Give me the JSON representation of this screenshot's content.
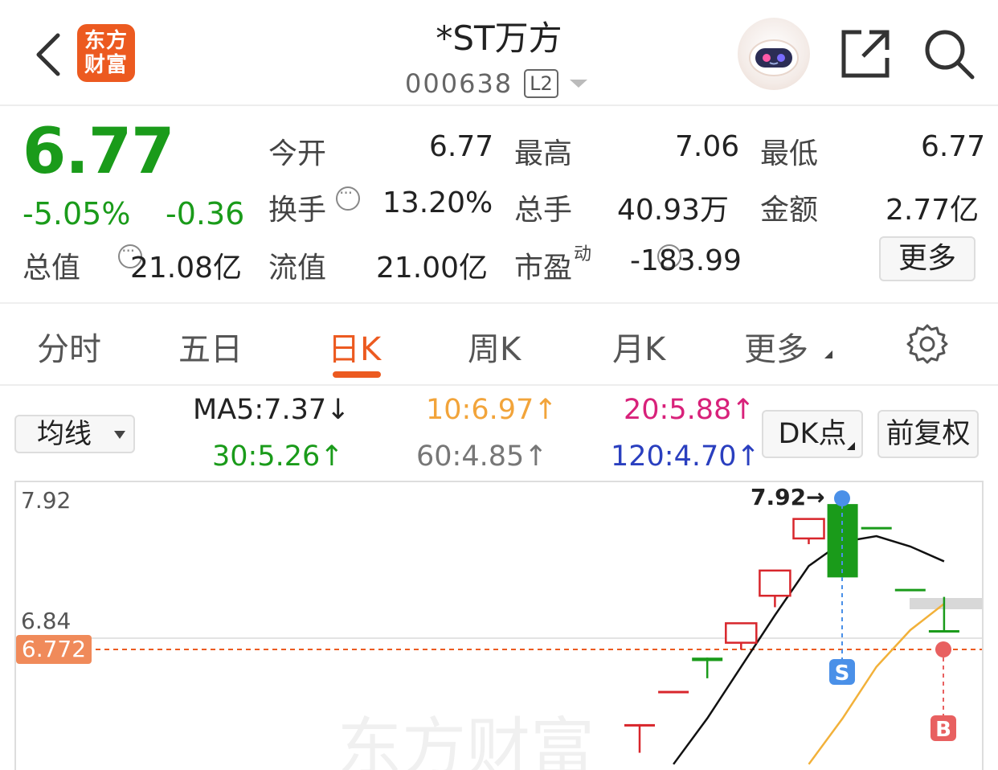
{
  "header": {
    "logo_line1": "东方",
    "logo_line2": "财富",
    "title": "*ST万方",
    "code": "000638",
    "level_badge": "L2",
    "icons": [
      "back-chevron-icon",
      "robot-avatar-icon",
      "share-icon",
      "search-icon"
    ]
  },
  "quote": {
    "price": "6.77",
    "change_pct": "-5.05%",
    "change": "-0.36",
    "cells": [
      {
        "label": "今开",
        "value": "6.77",
        "color": "#1a9b1a"
      },
      {
        "label": "最高",
        "value": "7.06",
        "color": "#1a9b1a"
      },
      {
        "label": "最低",
        "value": "6.77",
        "color": "#1a9b1a"
      },
      {
        "label": "换手",
        "value": "13.20%",
        "color": "#222"
      },
      {
        "label": "总手",
        "value": "40.93万",
        "color": "#222"
      },
      {
        "label": "金额",
        "value": "2.77亿",
        "color": "#222"
      },
      {
        "label": "总值",
        "value": "21.08亿",
        "color": "#222"
      },
      {
        "label": "流值",
        "value": "21.00亿",
        "color": "#222"
      },
      {
        "label": "市盈",
        "label_sup": "动",
        "value": "-183.99",
        "color": "#222"
      }
    ],
    "more_label": "更多"
  },
  "tabs": {
    "items": [
      "分时",
      "五日",
      "日K",
      "周K",
      "月K",
      "更多"
    ],
    "active": "日K"
  },
  "ma": {
    "dropdown_label": "均线",
    "ma5": "MA5:7.37",
    "ma5_arrow": "↓",
    "ma10": "10:6.97",
    "ma20": "20:5.88",
    "ma30": "30:5.26",
    "ma60": "60:4.85",
    "ma120": "120:4.70",
    "up_arrow": "↑",
    "dk_label": "DK点",
    "fq_label": "前复权",
    "colors": {
      "ma5": "#222",
      "ma10": "#f2a43a",
      "ma20": "#d8217a",
      "ma30": "#1a9b1a",
      "ma60": "#777",
      "ma120": "#2a3fbf"
    }
  },
  "chart": {
    "y_labels": [
      "7.92",
      "6.84"
    ],
    "current_price_tag": "6.772",
    "max_callout": "7.92→",
    "sell_marker": "S",
    "buy_marker": "B",
    "watermark": "东方财富",
    "colors": {
      "up": "#d8262c",
      "down": "#1a9b1a",
      "ma5": "#111",
      "ma10": "#f2b13a",
      "price_line": "#ec5a20",
      "sell": "#4a90e8",
      "buy": "#e86060"
    }
  },
  "chart_data": {
    "type": "candlestick",
    "visible_y_ticks": [
      7.92,
      6.84
    ],
    "current_price": 6.772,
    "period_high": 7.92,
    "candles": [
      {
        "open": 5.95,
        "close": 5.95,
        "high": 5.95,
        "low": 5.7,
        "dir": "up"
      },
      {
        "open": 6.24,
        "close": 6.24,
        "high": 6.24,
        "low": 6.24,
        "dir": "up"
      },
      {
        "open": 6.5,
        "close": 6.53,
        "high": 6.53,
        "low": 6.35,
        "dir": "down"
      },
      {
        "open": 6.66,
        "close": 6.83,
        "high": 6.83,
        "low": 6.6,
        "dir": "up"
      },
      {
        "open": 7.07,
        "close": 7.29,
        "high": 7.29,
        "low": 6.97,
        "dir": "up"
      },
      {
        "open": 7.57,
        "close": 7.74,
        "high": 7.74,
        "low": 7.52,
        "dir": "up"
      },
      {
        "open": 7.87,
        "close": 7.23,
        "high": 7.92,
        "low": 7.23,
        "dir": "down"
      },
      {
        "open": 7.67,
        "close": 7.67,
        "high": 7.67,
        "low": 7.67,
        "dir": "down"
      },
      {
        "open": 7.13,
        "close": 7.13,
        "high": 7.13,
        "low": 7.13,
        "dir": "down"
      },
      {
        "open": 6.77,
        "close": 6.77,
        "high": 7.06,
        "low": 6.77,
        "dir": "down"
      }
    ],
    "ma5_series": [
      5.6,
      6.0,
      6.45,
      6.9,
      7.33,
      7.54,
      7.59,
      7.5,
      7.37
    ],
    "ma10_series": [
      5.6,
      6.0,
      6.45,
      6.77,
      7.0
    ]
  }
}
